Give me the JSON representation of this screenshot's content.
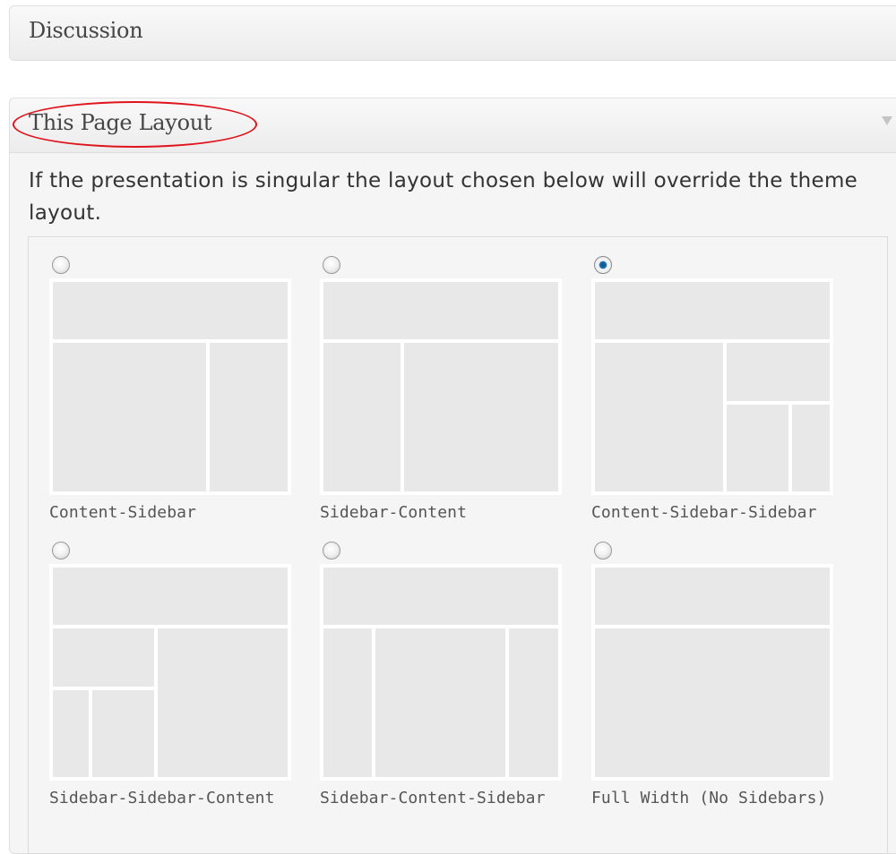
{
  "discussion_box": {
    "title": "Discussion"
  },
  "layout_box": {
    "title": "This Page Layout",
    "description": "If the presentation is singular the layout chosen below will override the theme layout.",
    "selected": "content-sidebar-sidebar",
    "options": [
      {
        "id": "content-sidebar",
        "label": "Content-Sidebar",
        "checked": false
      },
      {
        "id": "sidebar-content",
        "label": "Sidebar-Content",
        "checked": false
      },
      {
        "id": "content-sidebar-sidebar",
        "label": "Content-Sidebar-Sidebar",
        "checked": true
      },
      {
        "id": "sidebar-sidebar-content",
        "label": "Sidebar-Sidebar-Content",
        "checked": false
      },
      {
        "id": "sidebar-content-sidebar",
        "label": "Sidebar-Content-Sidebar",
        "checked": false
      },
      {
        "id": "full-width",
        "label": "Full Width (No Sidebars)",
        "checked": false
      }
    ]
  },
  "annotation": {
    "color": "#e0141c"
  },
  "colors": {
    "selected_radio": "#1d6fb0",
    "thumb_block": "#e8e8e8"
  }
}
